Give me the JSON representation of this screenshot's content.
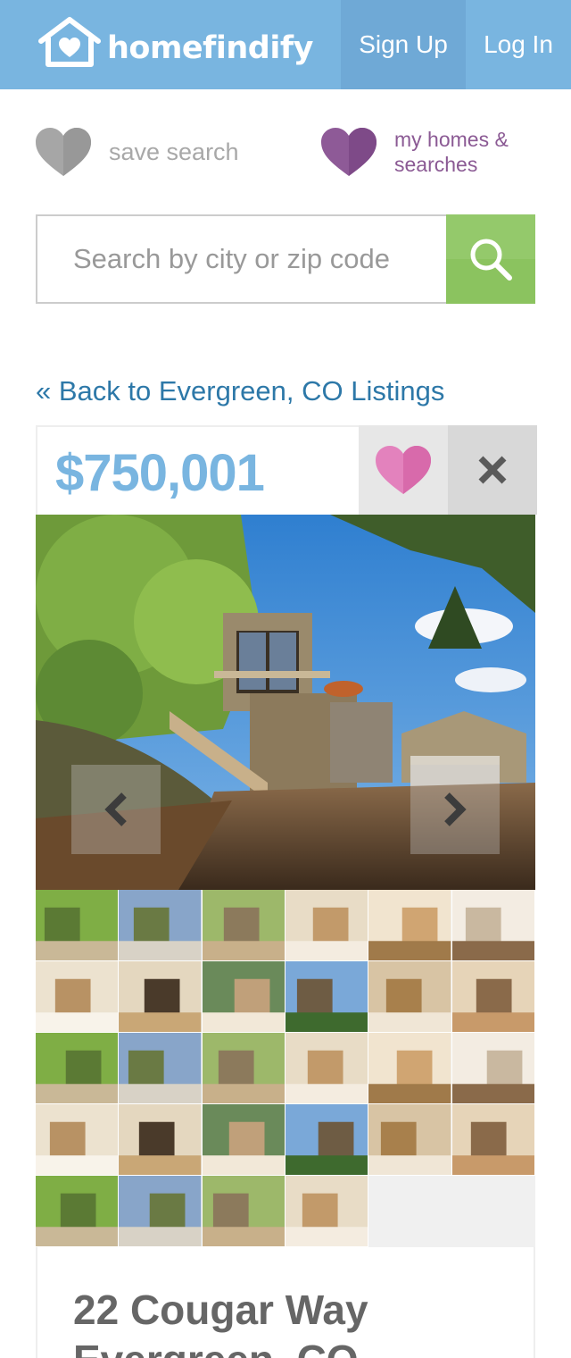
{
  "header": {
    "brand": "homefindify",
    "signup_label": "Sign Up",
    "login_label": "Log In",
    "colors": {
      "bar": "#79b5e0",
      "signup_bg": "#6fa9d6"
    }
  },
  "saved_bar": {
    "save_search_label": "save search",
    "my_homes_label": "my homes & searches"
  },
  "search": {
    "placeholder": "Search by city or zip code",
    "value": "",
    "button_color": "#8bc35f"
  },
  "back_link": "« Back to Evergreen, CO Listings",
  "listing": {
    "price": "$750,001",
    "address_line1": "22 Cougar Way",
    "address_line2": "Evergreen, CO",
    "photo_count": 28
  },
  "icons": [
    "house-heart-logo-icon",
    "heart-gray-icon",
    "heart-purple-icon",
    "search-icon",
    "heart-pink-icon",
    "close-icon",
    "chevron-left-icon",
    "chevron-right-icon"
  ],
  "colors": {
    "price": "#79b5e0",
    "link": "#2d78a8",
    "favorite_heart": "#e27ab8",
    "my_homes": "#8b5a94"
  }
}
